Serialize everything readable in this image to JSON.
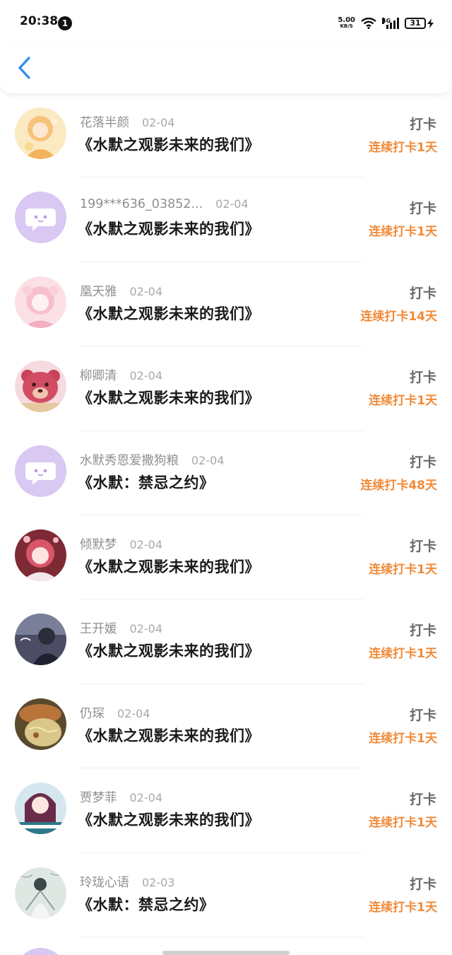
{
  "status_bar": {
    "time": "20:38",
    "notification_count": "1",
    "net_speed": "5.00",
    "net_unit": "KB/S",
    "network": "4G",
    "battery": "31"
  },
  "items": [
    {
      "name": "花落半颜",
      "date": "02-04",
      "title": "《水默之观影未来的我们》",
      "action": "打卡",
      "streak": "连续打卡1天",
      "avatar": "anime-girl-yellow"
    },
    {
      "name": "199***636_03852...",
      "date": "02-04",
      "title": "《水默之观影未来的我们》",
      "action": "打卡",
      "streak": "连续打卡1天",
      "avatar": "default-chat"
    },
    {
      "name": "凰天雅",
      "date": "02-04",
      "title": "《水默之观影未来的我们》",
      "action": "打卡",
      "streak": "连续打卡14天",
      "avatar": "anime-girl-pink"
    },
    {
      "name": "柳卿清",
      "date": "02-04",
      "title": "《水默之观影未来的我们》",
      "action": "打卡",
      "streak": "连续打卡1天",
      "avatar": "bear"
    },
    {
      "name": "水默秀恩爱撒狗粮",
      "date": "02-04",
      "title": "《水默：禁忌之约》",
      "action": "打卡",
      "streak": "连续打卡48天",
      "avatar": "default-chat"
    },
    {
      "name": "倾默梦",
      "date": "02-04",
      "title": "《水默之观影未来的我们》",
      "action": "打卡",
      "streak": "连续打卡1天",
      "avatar": "anime-girl-red"
    },
    {
      "name": "王开媛",
      "date": "02-04",
      "title": "《水默之观影未来的我们》",
      "action": "打卡",
      "streak": "连续打卡1天",
      "avatar": "photo-dark"
    },
    {
      "name": "仍琛",
      "date": "02-04",
      "title": "《水默之观影未来的我们》",
      "action": "打卡",
      "streak": "连续打卡1天",
      "avatar": "photo-food"
    },
    {
      "name": "贾梦菲",
      "date": "02-04",
      "title": "《水默之观影未来的我们》",
      "action": "打卡",
      "streak": "连续打卡1天",
      "avatar": "photo-girl"
    },
    {
      "name": "玲珑心语",
      "date": "02-03",
      "title": "《水默：禁忌之约》",
      "action": "打卡",
      "streak": "连续打卡1天",
      "avatar": "ink-figure"
    }
  ],
  "colors": {
    "accent_blue": "#2d8cf0",
    "streak_orange": "#f08b3a",
    "default_avatar_purple": "#d8c8f2"
  }
}
